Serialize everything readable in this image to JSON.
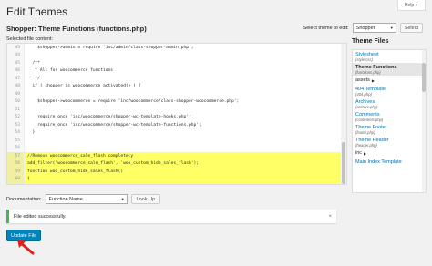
{
  "header": {
    "title": "Edit Themes",
    "help_label": "Help"
  },
  "file_heading": "Shopper: Theme Functions (functions.php)",
  "theme_select": {
    "label": "Select theme to edit:",
    "value": "Shopper",
    "button": "Select"
  },
  "selected_file_label": "Selected file content:",
  "code_lines": [
    {
      "n": "43",
      "t": "    $shopper->admin = require 'inc/admin/class-shopper-admin.php';",
      "hl": false
    },
    {
      "n": "44",
      "t": "",
      "hl": false
    },
    {
      "n": "45",
      "t": "  /**",
      "hl": false
    },
    {
      "n": "46",
      "t": "   * All for woocommerce functions",
      "hl": false
    },
    {
      "n": "47",
      "t": "   */",
      "hl": false
    },
    {
      "n": "48",
      "t": "  if ( shopper_is_woocommerce_activated() ) {",
      "hl": false
    },
    {
      "n": "49",
      "t": "",
      "hl": false
    },
    {
      "n": "50",
      "t": "    $shopper->woocommerce = require 'inc/woocommerce/class-shopper-woocommerce.php';",
      "hl": false
    },
    {
      "n": "51",
      "t": "",
      "hl": false
    },
    {
      "n": "52",
      "t": "    require_once 'inc/woocommerce/shopper-wc-template-hooks.php';",
      "hl": false
    },
    {
      "n": "53",
      "t": "    require_once 'inc/woocommerce/shopper-wc-template-functions.php';",
      "hl": false
    },
    {
      "n": "54",
      "t": "  }",
      "hl": false
    },
    {
      "n": "55",
      "t": "",
      "hl": false
    },
    {
      "n": "56",
      "t": "",
      "hl": false
    },
    {
      "n": "57",
      "t": "//Remove woocommerce_sale_flash completely",
      "hl": true
    },
    {
      "n": "58",
      "t": "add_filter('woocommerce_sale_flash', 'woo_custom_hide_sales_flash');",
      "hl": true
    },
    {
      "n": "59",
      "t": "function woo_custom_hide_sales_flash()",
      "hl": true
    },
    {
      "n": "60",
      "t": "{",
      "hl": true
    },
    {
      "n": "61",
      "t": "  return false;",
      "hl": true
    },
    {
      "n": "62",
      "t": "}",
      "hl": true
    }
  ],
  "sidebar": {
    "title": "Theme Files",
    "items": [
      {
        "name": "Stylesheet",
        "file": "(style.css)",
        "active": false,
        "type": "file"
      },
      {
        "name": "Theme Functions",
        "file": "(functions.php)",
        "active": true,
        "type": "file"
      },
      {
        "name": "assets",
        "type": "folder"
      },
      {
        "name": "404 Template",
        "file": "(404.php)",
        "active": false,
        "type": "file"
      },
      {
        "name": "Archives",
        "file": "(archive.php)",
        "active": false,
        "type": "file"
      },
      {
        "name": "Comments",
        "file": "(comments.php)",
        "active": false,
        "type": "file"
      },
      {
        "name": "Theme Footer",
        "file": "(footer.php)",
        "active": false,
        "type": "file"
      },
      {
        "name": "Theme Header",
        "file": "(header.php)",
        "active": false,
        "type": "file"
      },
      {
        "name": "inc",
        "type": "folder"
      },
      {
        "name": "Main Index Template",
        "file": "",
        "active": false,
        "type": "file"
      }
    ]
  },
  "documentation": {
    "label": "Documentation:",
    "select_value": "Function Name...",
    "button": "Look Up"
  },
  "notice": {
    "message": "File edited successfully.",
    "dismiss": "×"
  },
  "update_button": "Update File",
  "colors": {
    "primary": "#0085ba",
    "highlight": "#ffff66",
    "success": "#46b450",
    "arrow": "#e02020"
  }
}
